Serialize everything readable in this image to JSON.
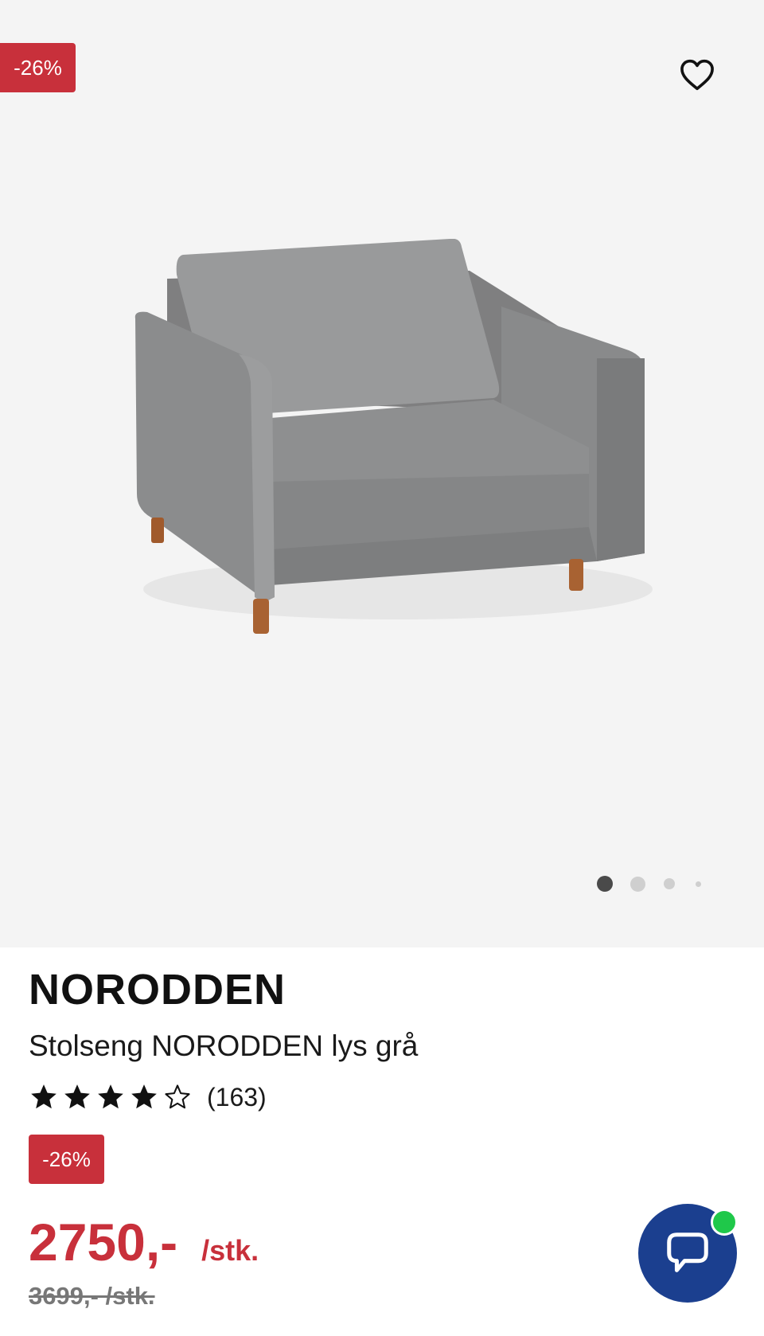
{
  "gallery": {
    "discount_badge": "-26%",
    "favorite_icon": "heart-outline-icon",
    "image_alt": "Stolseng NORODDEN lys grå",
    "slide_count": 4,
    "active_slide": 1
  },
  "product": {
    "brand": "NORODDEN",
    "name": "Stolseng NORODDEN lys grå",
    "rating": 4,
    "rating_max": 5,
    "review_count": "(163)",
    "discount_badge": "-26%",
    "price": "2750,-",
    "price_unit": "/stk.",
    "old_price": "3699,- /stk."
  },
  "chat": {
    "icon": "chat-bubble-icon",
    "status_color": "#1fc84a"
  },
  "colors": {
    "sale_red": "#c8303b",
    "chat_blue": "#1b3f8f"
  }
}
